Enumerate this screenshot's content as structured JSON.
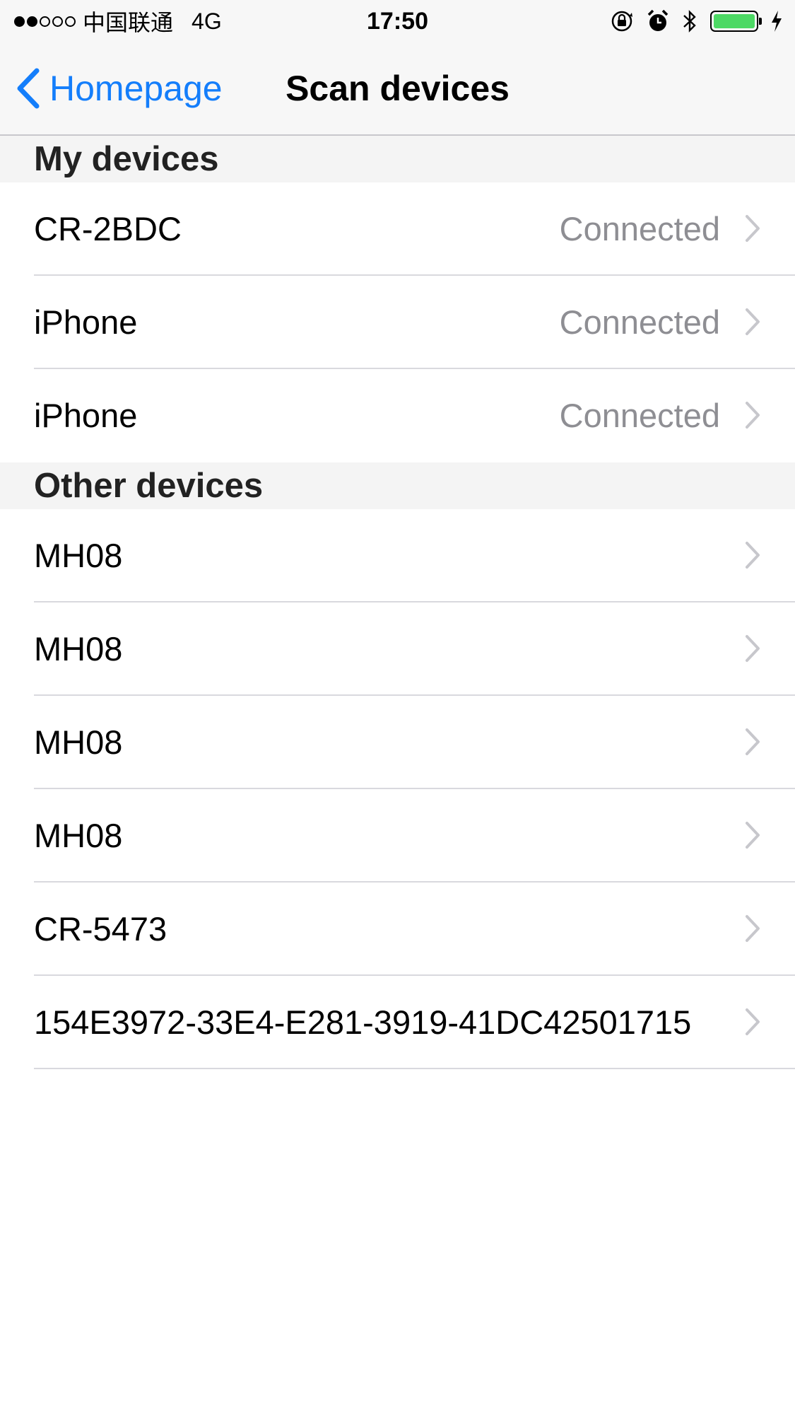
{
  "status_bar": {
    "carrier": "中国联通",
    "network": "4G",
    "time": "17:50",
    "battery_color": "#4cd964"
  },
  "nav": {
    "back_label": "Homepage",
    "title": "Scan devices",
    "accent_color": "#147efb"
  },
  "sections": {
    "my_devices": {
      "header": "My devices",
      "rows": [
        {
          "name": "CR-2BDC",
          "status": "Connected"
        },
        {
          "name": "iPhone",
          "status": "Connected"
        },
        {
          "name": "iPhone",
          "status": "Connected"
        }
      ]
    },
    "other_devices": {
      "header": "Other devices",
      "rows": [
        {
          "name": "MH08"
        },
        {
          "name": "MH08"
        },
        {
          "name": "MH08"
        },
        {
          "name": "MH08"
        },
        {
          "name": "CR-5473"
        },
        {
          "name": "154E3972-33E4-E281-3919-41DC42501715"
        }
      ]
    }
  },
  "icons": [
    "signal-dots-icon",
    "orientation-lock-icon",
    "alarm-icon",
    "bluetooth-icon",
    "battery-icon",
    "charging-bolt-icon",
    "back-chevron-icon",
    "chevron-right-icon"
  ]
}
